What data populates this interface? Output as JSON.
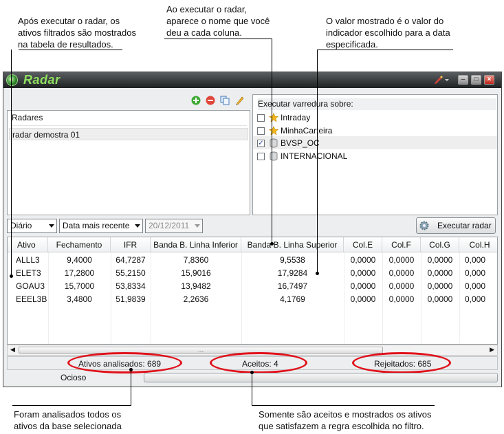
{
  "annotations": {
    "top_left": "Após executar o radar, os\nativos filtrados são mostrados\nna tabela de resultados.",
    "top_middle": "Ao executar o radar,\naparece o nome que você\ndeu a cada coluna.",
    "top_right": "O valor mostrado é o valor do\nindicador escolhido para a data\nespecificada.",
    "bottom_left": "Foram analisados todos os\nativos da base selecionada",
    "bottom_right": "Somente são aceitos e mostrados os ativos\nque satisfazem a regra escolhida no filtro."
  },
  "window": {
    "title": "Radar",
    "colors": {
      "title_text": "#8fe060",
      "annotation_ellipse": "#e0101a"
    }
  },
  "radars": {
    "header": "Radares",
    "items": [
      "radar demostra 01"
    ]
  },
  "sweep": {
    "header": "Executar varredura sobre:",
    "items": [
      {
        "label": "Intraday",
        "checked": false,
        "icon": "star-icon"
      },
      {
        "label": "MinhaCarteira",
        "checked": false,
        "icon": "star-icon"
      },
      {
        "label": "BVSP_OC",
        "checked": true,
        "icon": "database-icon"
      },
      {
        "label": "INTERNACIONAL",
        "checked": false,
        "icon": "database-icon"
      }
    ]
  },
  "controls": {
    "period": "Diário",
    "date_mode": "Data mais recente",
    "date": "20/12/2011",
    "run_label": "Executar radar"
  },
  "table": {
    "columns": [
      "Ativo",
      "Fechamento",
      "IFR",
      "Banda B. Linha Inferior",
      "Banda B. Linha Superior",
      "Col.E",
      "Col.F",
      "Col.G",
      "Col.H"
    ],
    "rows": [
      [
        "ALLL3",
        "9,4000",
        "64,7287",
        "7,8360",
        "9,5538",
        "0,0000",
        "0,0000",
        "0,0000",
        "0,000"
      ],
      [
        "ELET3",
        "17,2800",
        "55,2150",
        "15,9016",
        "17,9284",
        "0,0000",
        "0,0000",
        "0,0000",
        "0,000"
      ],
      [
        "GOAU3",
        "15,7000",
        "53,8334",
        "13,9482",
        "16,7497",
        "0,0000",
        "0,0000",
        "0,0000",
        "0,000"
      ],
      [
        "EEEL3B",
        "3,4800",
        "51,9839",
        "2,2636",
        "4,1769",
        "0,0000",
        "0,0000",
        "0,0000",
        "0,000"
      ]
    ]
  },
  "status": {
    "analyzed": "Ativos analisados: 689",
    "accepted": "Aceitos: 4",
    "rejected": "Rejeitados: 685",
    "state": "Ocioso"
  }
}
